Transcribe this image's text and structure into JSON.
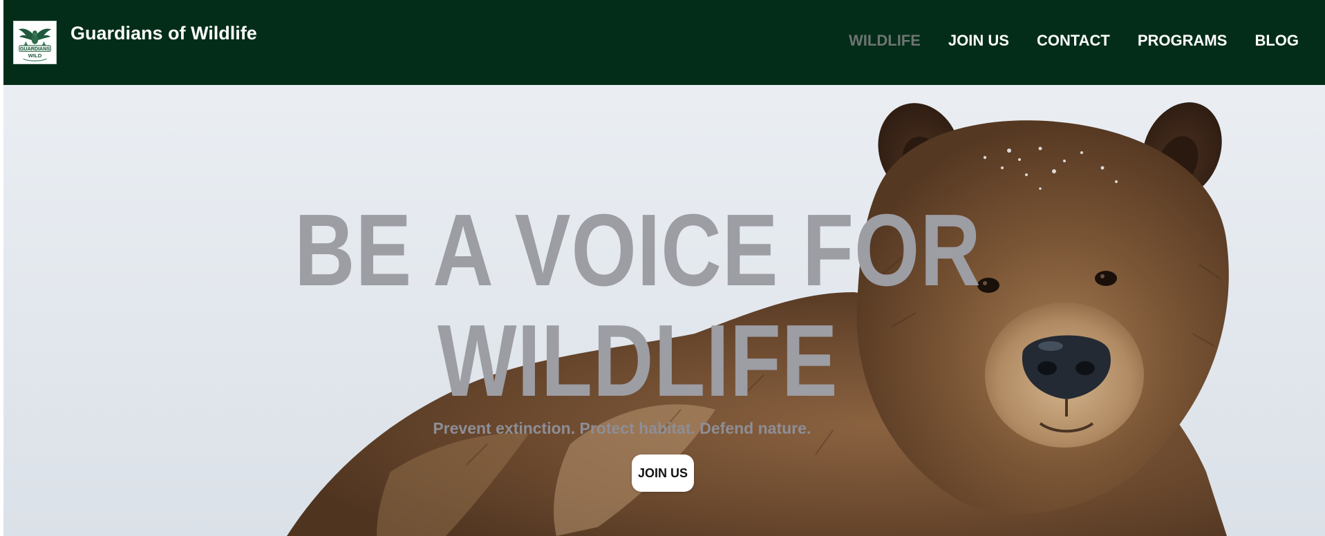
{
  "header": {
    "site_title": "Guardians of Wildlife",
    "logo": {
      "icon": "eagle-emblem-icon",
      "text_line1": "GUARDIANS",
      "text_line2": "WILD"
    },
    "nav": [
      {
        "label": "WILDLIFE",
        "active": true
      },
      {
        "label": "JOIN US",
        "active": false
      },
      {
        "label": "CONTACT",
        "active": false
      },
      {
        "label": "PROGRAMS",
        "active": false
      },
      {
        "label": "BLOG",
        "active": false
      }
    ]
  },
  "hero": {
    "headline_line1": "BE A VOICE FOR",
    "headline_line2": "WILDLIFE",
    "tagline": "Prevent extinction. Protect habitat. Defend nature.",
    "cta_label": "JOIN US",
    "background_image": "grizzly-bear-in-snow"
  },
  "colors": {
    "navbar_bg": "#032d18",
    "nav_text": "#ffffff",
    "nav_active_text": "#6d7572",
    "headline": "#9d9da4",
    "cta_bg": "#ffffff"
  }
}
